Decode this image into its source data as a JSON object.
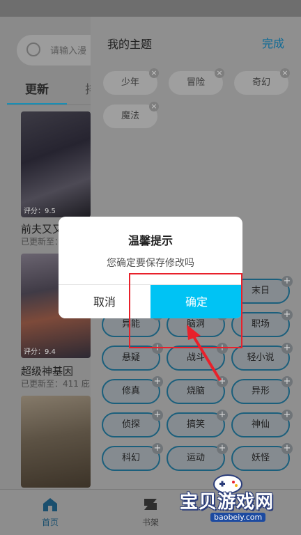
{
  "main": {
    "search_placeholder": "请输入漫",
    "tabs": [
      {
        "label": "更新",
        "active": true
      },
      {
        "label": "排",
        "active": false
      }
    ],
    "cards": [
      {
        "title": "前夫又又",
        "subtitle": "已更新至：",
        "score": "评分：9.5"
      },
      {
        "title": "超级神基因",
        "subtitle": "已更新至：411 庇",
        "score": "评分：9.4"
      },
      {
        "title": "",
        "subtitle": "",
        "score": ""
      }
    ]
  },
  "bottom_nav": {
    "items": [
      {
        "label": "首页",
        "icon": "home-icon",
        "active": true
      },
      {
        "label": "书架",
        "icon": "bookshelf-icon",
        "active": false
      }
    ]
  },
  "panel": {
    "title": "我的主题",
    "done_label": "完成",
    "my_topics": [
      "少年",
      "冒险",
      "奇幻",
      "魔法"
    ],
    "available_topics": [
      "末日",
      "异能",
      "脑洞",
      "职场",
      "悬疑",
      "战斗",
      "轻小说",
      "修真",
      "烧脑",
      "异形",
      "侦探",
      "搞笑",
      "神仙",
      "科幻",
      "运动",
      "妖怪"
    ]
  },
  "dialog": {
    "title": "温馨提示",
    "message": "您确定要保存修改吗",
    "cancel_label": "取消",
    "ok_label": "确定",
    "ok_color": "#00c3f4"
  },
  "watermark": {
    "name": "宝贝游戏网",
    "url": "baobeiy.com"
  },
  "colors": {
    "accent": "#00c3f4",
    "annotation": "#e8212b"
  }
}
